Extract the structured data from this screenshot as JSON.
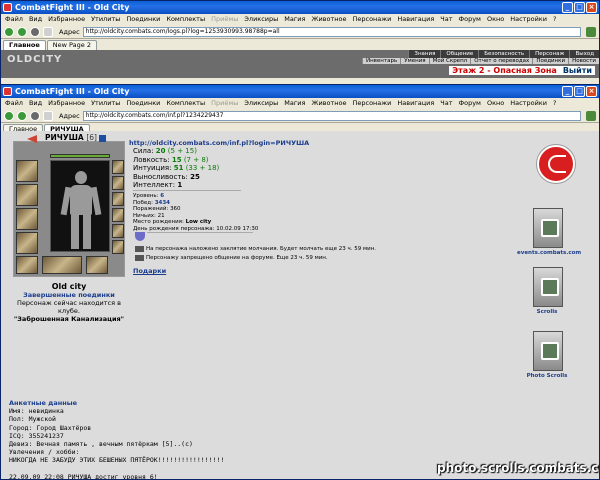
{
  "window1": {
    "title": "CombatFight III - Old City",
    "menu": [
      "Файл",
      "Вид",
      "Избранное",
      "Утилиты",
      "Поединки",
      "Комплекты",
      "Приёмы",
      "Эликсиры",
      "Магия",
      "Животное",
      "Персонажи",
      "Навигация",
      "Чат",
      "Форум",
      "Окно",
      "Настройки",
      "?"
    ],
    "menu_dim_index": 6,
    "address_label": "Адрес",
    "address": "http://oldcity.combats.com/logs.pl?log=1253930993.98788p=all",
    "tabs": [
      "Главное",
      "New Page 2"
    ],
    "nav_top": [
      "Знания",
      "Общение",
      "Безопасность",
      "Персонаж",
      "Выход"
    ],
    "nav_row2": [
      "Инвентарь",
      "Умения",
      "Мой Скрепл",
      "Отчет о переводах",
      "Поединки",
      "Новости"
    ],
    "zone_text": "Этаж 2 - Опасная Зона",
    "exit_text": "Выйти",
    "logo_text": "OLDCITY"
  },
  "window2": {
    "title": "CombatFight III - Old City",
    "menu": [
      "Файл",
      "Вид",
      "Избранное",
      "Утилиты",
      "Поединки",
      "Комплекты",
      "Приёмы",
      "Эликсиры",
      "Магия",
      "Животное",
      "Персонажи",
      "Навигация",
      "Чат",
      "Форум",
      "Окно",
      "Настройки",
      "?"
    ],
    "menu_dim_index": 6,
    "address_label": "Адрес",
    "address": "http://oldcity.combats.com/inf.pl?1234229437",
    "tabs": [
      "Главное",
      "РИЧУША"
    ]
  },
  "character": {
    "name": "РИЧУША",
    "level": "[6]",
    "info_link": "http://oldcity.combats.com/inf.pl?login=РИЧУША",
    "location_city": "Old city",
    "location_link": "Завершенные поединки",
    "location_status": "Персонаж сейчас находится в клубе.",
    "location_room": "\"Заброшенная Канализация\""
  },
  "stats": [
    {
      "label": "Сила:",
      "value": "20",
      "bonus": "(5 + 15)"
    },
    {
      "label": "Ловкость:",
      "value": "15",
      "bonus": "(7 + 8)"
    },
    {
      "label": "Интуиция:",
      "value": "51",
      "bonus": "(33 + 18)"
    },
    {
      "label": "Выносливость:",
      "value": "25",
      "bonus": ""
    },
    {
      "label": "Интеллект:",
      "value": "1",
      "bonus": ""
    }
  ],
  "misc": {
    "level_label": "Уровень:",
    "level_value": "6",
    "wins_label": "Побед:",
    "wins_value": "3434",
    "losses_label": "Поражений:",
    "losses_value": "360",
    "draws_label": "Ничьих:",
    "draws_value": "21",
    "birthplace_label": "Место рождения:",
    "birthplace_value": "Low city",
    "birthday_label": "День рождения персонажа:",
    "birthday_value": "10.02.09 17:30"
  },
  "messages": [
    "На персонажа наложено заклятие молчания. Будет молчать еще 23 ч. 59 мин.",
    "Персонажу запрещено общение на форуме. Еще 23 ч. 59 мин."
  ],
  "gifts_label": "Подарки",
  "right_column": {
    "banner1_label": "events.combats.com",
    "banner2_label": "Scrolls",
    "banner3_label": "Photo Scrolls"
  },
  "anketa": {
    "header": "Анкетные данные",
    "lines": [
      "Имя: невидинка",
      "Пол: Мужской",
      "Город: Город Шахтёров",
      "ICQ: 355241237",
      "Девиз: Вечная память , вечным пятёркам [5]..(c)",
      "Увлечения / хобби:",
      "НИКОГДА НЕ ЗАБУДУ ЭТИХ БЕШЕНЫХ ПЯТЁРОК!!!!!!!!!!!!!!!!!",
      "",
      "22.09.09 22:08 РИЧУША достиг уровня 6!"
    ]
  },
  "watermark": "photo.scrolls.combats.com"
}
